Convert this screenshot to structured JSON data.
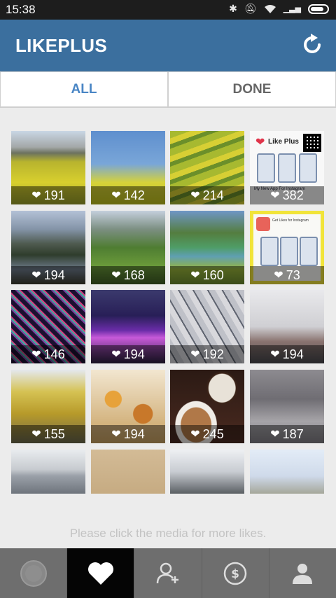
{
  "status_bar": {
    "time": "15:38"
  },
  "app": {
    "title": "LIKEPLUS"
  },
  "tabs": [
    {
      "label": "ALL",
      "active": true
    },
    {
      "label": "DONE",
      "active": false
    }
  ],
  "grid": [
    {
      "likes": "191",
      "kind": "rapeseed-field"
    },
    {
      "likes": "142",
      "kind": "yellow-flowers-sky"
    },
    {
      "likes": "214",
      "kind": "terraced-fields"
    },
    {
      "likes": "382",
      "kind": "promo-like-plus",
      "promo_title": "Like Plus",
      "promo_sub": "My New App For Instagram"
    },
    {
      "likes": "194",
      "kind": "mountains-lake"
    },
    {
      "likes": "168",
      "kind": "green-valley"
    },
    {
      "likes": "160",
      "kind": "karst-landscape"
    },
    {
      "likes": "73",
      "kind": "promo-get-likes",
      "promo_title": "Get Likes for Instagram",
      "promo_sub": ""
    },
    {
      "likes": "146",
      "kind": "light-dome"
    },
    {
      "likes": "194",
      "kind": "concert-stage"
    },
    {
      "likes": "192",
      "kind": "steel-bridge"
    },
    {
      "likes": "194",
      "kind": "harbor-crane"
    },
    {
      "likes": "155",
      "kind": "autumn-tree"
    },
    {
      "likes": "194",
      "kind": "ginkgo-leaves"
    },
    {
      "likes": "245",
      "kind": "coffee-cups"
    },
    {
      "likes": "187",
      "kind": "portrait-collage"
    },
    {
      "likes": "",
      "kind": "sea-sunset"
    },
    {
      "likes": "",
      "kind": "sand-footprints"
    },
    {
      "likes": "",
      "kind": "bare-trees"
    },
    {
      "likes": "",
      "kind": "pagoda-sky"
    }
  ],
  "hint": "Please click the media for more likes.",
  "bottom_nav": [
    {
      "icon": "record-circle-icon",
      "active": false
    },
    {
      "icon": "heart-icon",
      "active": true
    },
    {
      "icon": "add-follower-icon",
      "active": false
    },
    {
      "icon": "coin-icon",
      "active": false
    },
    {
      "icon": "profile-icon",
      "active": false
    }
  ],
  "colors": {
    "app_bar": "#3b6f9e",
    "tab_active": "#4a86c5",
    "nav_bg": "#6e6e6e",
    "nav_active": "#050505"
  }
}
